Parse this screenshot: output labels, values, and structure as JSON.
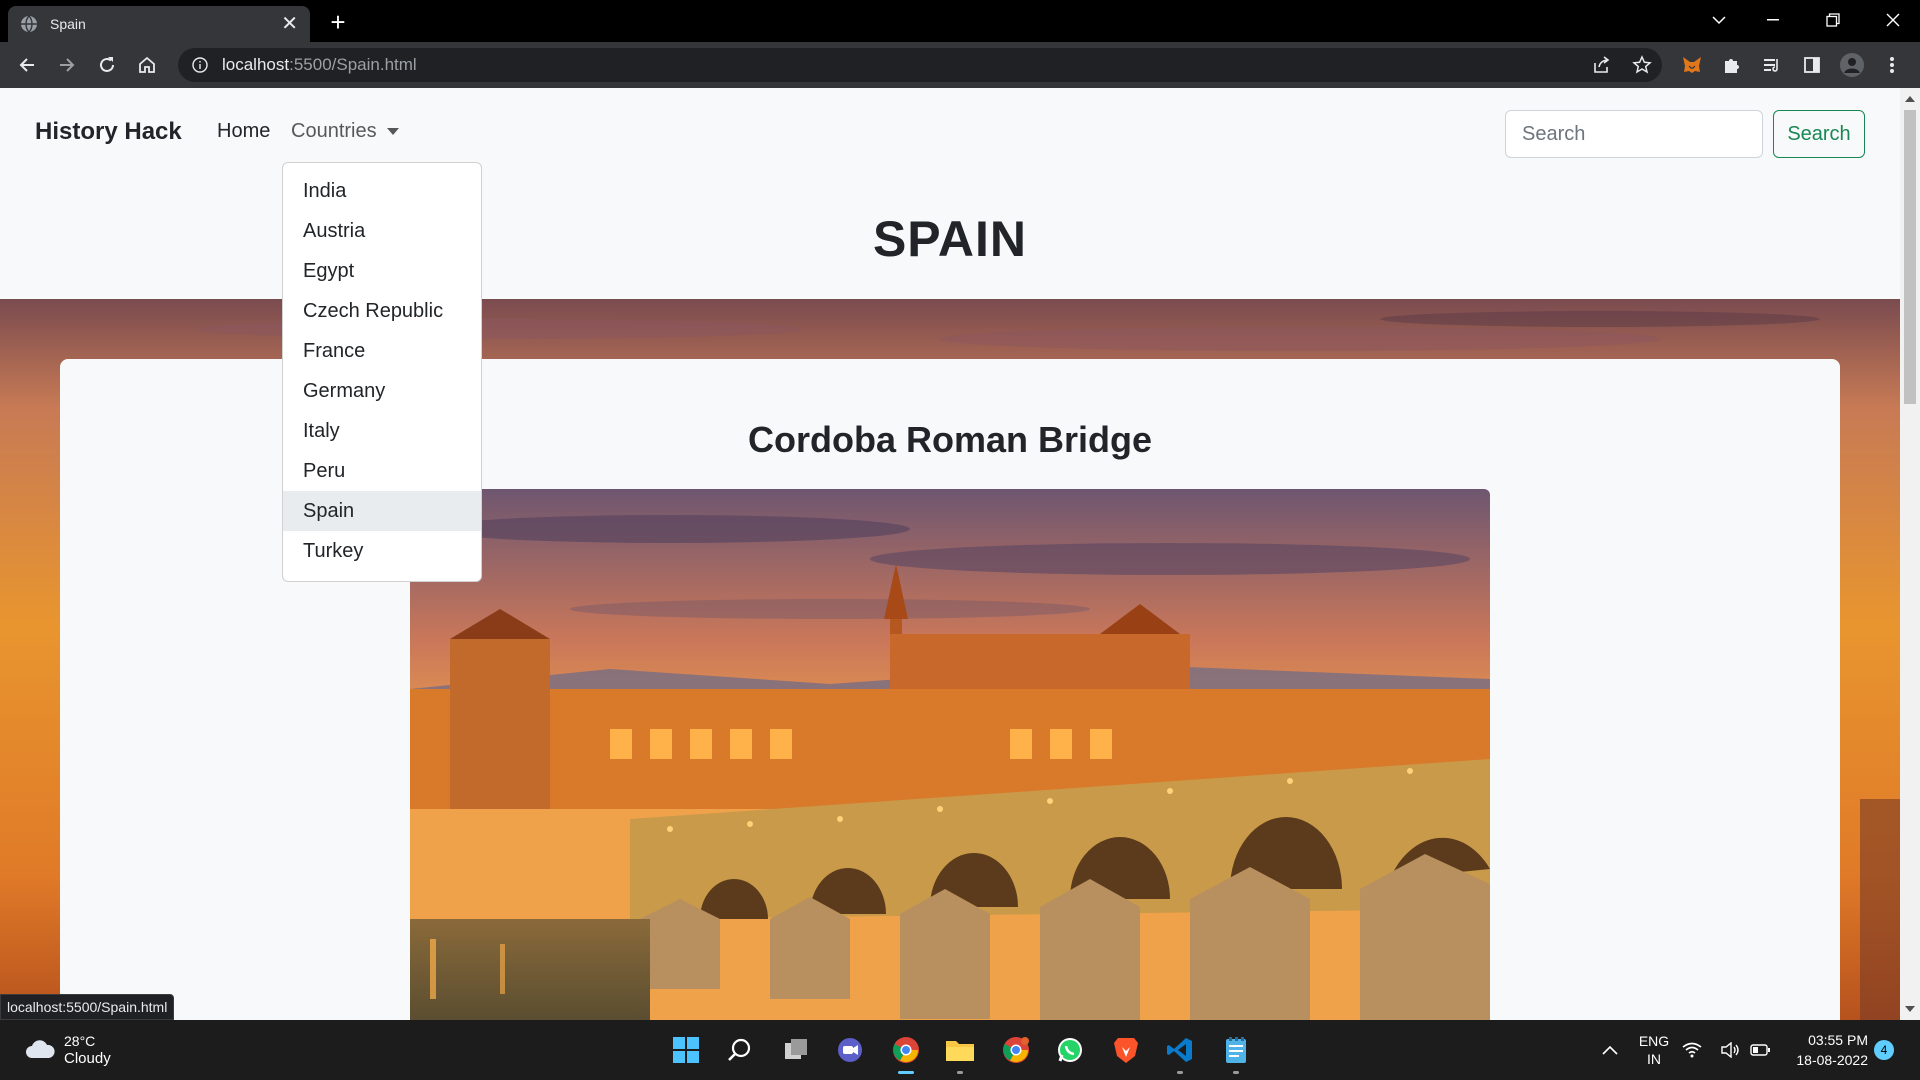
{
  "browser": {
    "tab_title": "Spain",
    "url_host": "localhost",
    "url_rest": ":5500/Spain.html",
    "status_url": "localhost:5500/Spain.html"
  },
  "navbar": {
    "brand": "History Hack",
    "home": "Home",
    "countries": "Countries",
    "search_placeholder": "Search",
    "search_button": "Search"
  },
  "dropdown": {
    "items": [
      "India",
      "Austria",
      "Egypt",
      "Czech Republic",
      "France",
      "Germany",
      "Italy",
      "Peru",
      "Spain",
      "Turkey"
    ],
    "active": "Spain"
  },
  "page": {
    "title": "SPAIN",
    "card_title": "Cordoba Roman Bridge"
  },
  "taskbar": {
    "weather_temp": "28°C",
    "weather_cond": "Cloudy",
    "lang_top": "ENG",
    "lang_bottom": "IN",
    "time": "03:55 PM",
    "date": "18-08-2022",
    "notifications": "4"
  },
  "colors": {
    "accent_green": "#198754",
    "taskbar_accent": "#60cdff"
  }
}
